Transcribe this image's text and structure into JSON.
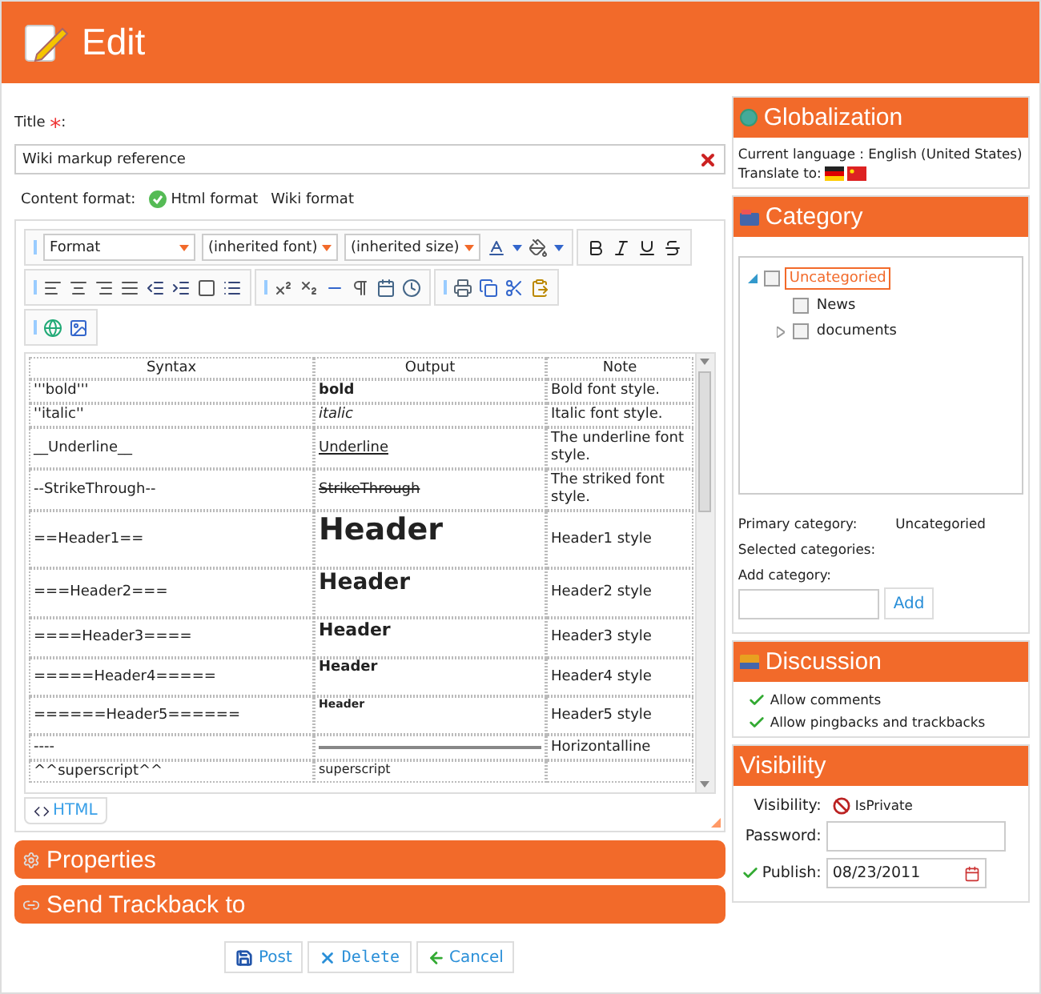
{
  "header": {
    "title": "Edit"
  },
  "title_field": {
    "label": "Title",
    "required_mark": "*",
    "colon": ":",
    "value": "Wiki markup reference"
  },
  "content_format": {
    "label": "Content format:",
    "options": [
      {
        "label": "Html format",
        "selected": true
      },
      {
        "label": "Wiki format",
        "selected": false
      }
    ]
  },
  "editor": {
    "selects": [
      "Format",
      "(inherited font)",
      "(inherited size)"
    ],
    "table": {
      "columns": [
        "Syntax",
        "Output",
        "Note"
      ],
      "rows": [
        {
          "syntax": "'''bold'''",
          "kind": "bold",
          "output": "bold",
          "note": "Bold font style."
        },
        {
          "syntax": "''italic''",
          "kind": "italic",
          "output": "italic",
          "note": "Italic font style."
        },
        {
          "syntax": "__Underline__",
          "kind": "underline",
          "output": "Underline",
          "note": "The underline font style."
        },
        {
          "syntax": "--StrikeThrough--",
          "kind": "strike",
          "output": "StrikeThrough",
          "note": "The striked font style."
        },
        {
          "syntax": "==Header1==",
          "kind": "h1",
          "output": "Header",
          "note": "Header1 style"
        },
        {
          "syntax": "===Header2===",
          "kind": "h2",
          "output": "Header",
          "note": "Header2 style"
        },
        {
          "syntax": "====Header3====",
          "kind": "h3",
          "output": "Header",
          "note": "Header3 style"
        },
        {
          "syntax": "=====Header4=====",
          "kind": "h4",
          "output": "Header",
          "note": "Header4 style"
        },
        {
          "syntax": "======Header5======",
          "kind": "h5",
          "output": "Header",
          "note": "Header5 style"
        },
        {
          "syntax": "----",
          "kind": "hr",
          "note": "Horizontalline"
        },
        {
          "syntax": "^^superscript^^",
          "kind": "sup",
          "output": "superscript"
        }
      ]
    },
    "mode_tab": {
      "label": "HTML"
    }
  },
  "panels": [
    {
      "title": "Properties",
      "kind": "gear"
    },
    {
      "title": "Send Trackback to",
      "kind": "link"
    }
  ],
  "actions": [
    {
      "label": "Post",
      "kind": "post"
    },
    {
      "label": "Delete",
      "kind": "delete"
    },
    {
      "label": "Cancel",
      "kind": "cancel"
    }
  ],
  "globalization": {
    "title": "Globalization",
    "current": "Current language : English (United States)",
    "translate_label": "Translate to:"
  },
  "category": {
    "title": "Category",
    "tree": [
      {
        "label": "Uncategoried",
        "checked": false,
        "selected": true,
        "expanded": true,
        "children": [
          {
            "label": "News",
            "checked": false,
            "selected": false
          },
          {
            "label": "documents",
            "checked": false,
            "selected": false,
            "expanded": false
          }
        ]
      }
    ],
    "primary_label": "Primary category:",
    "primary_value": "Uncategoried",
    "selected_label": "Selected categories:",
    "add_label": "Add category:",
    "add_button": "Add"
  },
  "discussion": {
    "title": "Discussion",
    "items": [
      {
        "label": "Allow comments",
        "checked": true
      },
      {
        "label": "Allow pingbacks and trackbacks",
        "checked": true
      }
    ]
  },
  "visibility": {
    "title": "Visibility",
    "visibility_label": "Visibility:",
    "visibility_value": "IsPrivate",
    "password_label": "Password:",
    "publish_label": "Publish:",
    "publish_checked": true,
    "publish_value": "08/23/2011"
  }
}
